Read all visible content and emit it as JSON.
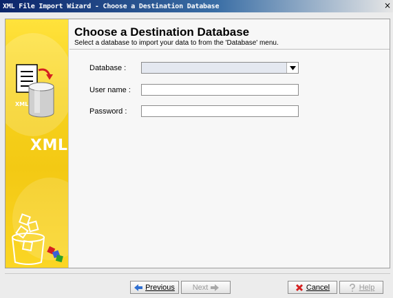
{
  "window": {
    "title": "XML File Import Wizard - Choose a Destination Database",
    "close_glyph": "×"
  },
  "sidebar": {
    "xml_text": "XML",
    "doc_icon_label": "XML"
  },
  "page": {
    "heading": "Choose a Destination Database",
    "subheading": "Select a database to import your data to from the 'Database' menu."
  },
  "form": {
    "database": {
      "label": "Database :",
      "value": ""
    },
    "username": {
      "label": "User name :",
      "value": "",
      "placeholder": ""
    },
    "password": {
      "label": "Password :",
      "value": "",
      "placeholder": ""
    }
  },
  "buttons": {
    "previous": {
      "label": "Previous",
      "icon": "arrow-left-icon",
      "enabled": true
    },
    "next": {
      "label": "Next",
      "icon": "arrow-right-icon",
      "enabled": false
    },
    "cancel": {
      "label": "Cancel",
      "icon": "red-x-icon",
      "enabled": true
    },
    "help": {
      "label": "Help",
      "icon": "question-icon",
      "enabled": false
    }
  },
  "colors": {
    "titlebar": "#0a246a",
    "sidebar": "#f7d31d",
    "arrow_blue": "#2f6fd1",
    "cancel_red": "#d42020"
  }
}
